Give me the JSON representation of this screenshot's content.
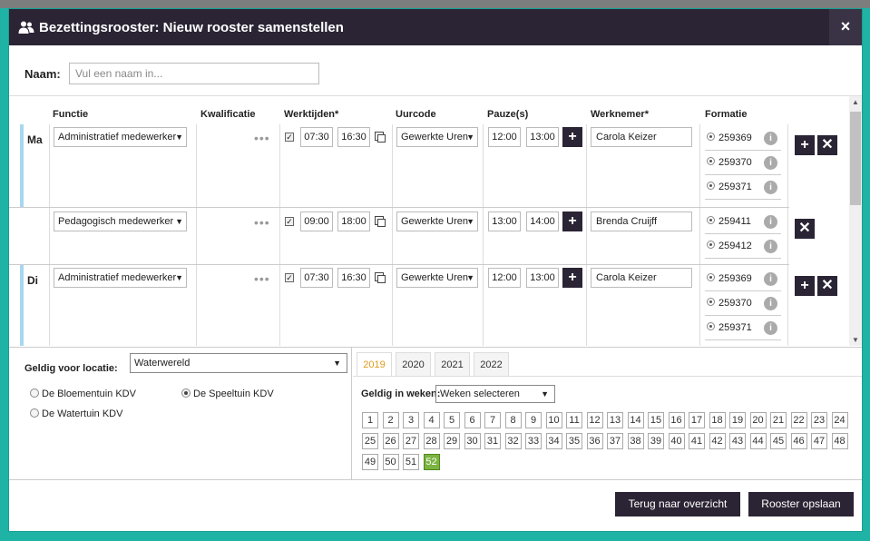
{
  "dialog": {
    "title": "Bezettingsrooster: Nieuw rooster samenstellen",
    "close_label": "×",
    "title_icon": "users-icon"
  },
  "name": {
    "label": "Naam:",
    "placeholder": "Vul een naam in...",
    "value": ""
  },
  "columns": {
    "functie": "Functie",
    "kwalificatie": "Kwalificatie",
    "werktijden": "Werktijden*",
    "uurcode": "Uurcode",
    "pauze": "Pauze(s)",
    "werknemer": "Werknemer*",
    "formatie": "Formatie"
  },
  "rows": [
    {
      "day": "Ma",
      "functie": "Administratief medewerker",
      "kwalificatie": "•••",
      "checked": true,
      "start": "07:30",
      "end": "16:30",
      "uurcode": "Gewerkte Uren",
      "pauze_start": "12:00",
      "pauze_end": "13:00",
      "werknemer": "Carola Keizer",
      "formatie": [
        "259369",
        "259370",
        "259371"
      ]
    },
    {
      "day": "",
      "functie": "Pedagogisch medewerker",
      "kwalificatie": "•••",
      "checked": true,
      "start": "09:00",
      "end": "18:00",
      "uurcode": "Gewerkte Uren",
      "pauze_start": "13:00",
      "pauze_end": "14:00",
      "werknemer": "Brenda Cruijff",
      "formatie": [
        "259411",
        "259412"
      ]
    },
    {
      "day": "Di",
      "functie": "Administratief medewerker",
      "kwalificatie": "•••",
      "checked": true,
      "start": "07:30",
      "end": "16:30",
      "uurcode": "Gewerkte Uren",
      "pauze_start": "12:00",
      "pauze_end": "13:00",
      "werknemer": "Carola Keizer",
      "formatie": [
        "259369",
        "259370",
        "259371"
      ]
    }
  ],
  "location": {
    "label": "Geldig voor locatie:",
    "selected": "Waterwereld",
    "options": [
      {
        "label": "De Bloementuin KDV",
        "checked": false
      },
      {
        "label": "De Speeltuin KDV",
        "checked": true
      },
      {
        "label": "De Watertuin KDV",
        "checked": false
      }
    ]
  },
  "years": {
    "tabs": [
      "2019",
      "2020",
      "2021",
      "2022"
    ],
    "active": "2019"
  },
  "weeks": {
    "label": "Geldig in weken:",
    "select_value": "Weken selecteren",
    "selected": [
      52
    ]
  },
  "footer": {
    "back_label": "Terug naar overzicht",
    "save_label": "Rooster opslaan"
  },
  "colors": {
    "accent": "#2b2434",
    "frame": "#1fb3a6",
    "selected_week": "#7cb342",
    "active_tab": "#e09a1a"
  }
}
